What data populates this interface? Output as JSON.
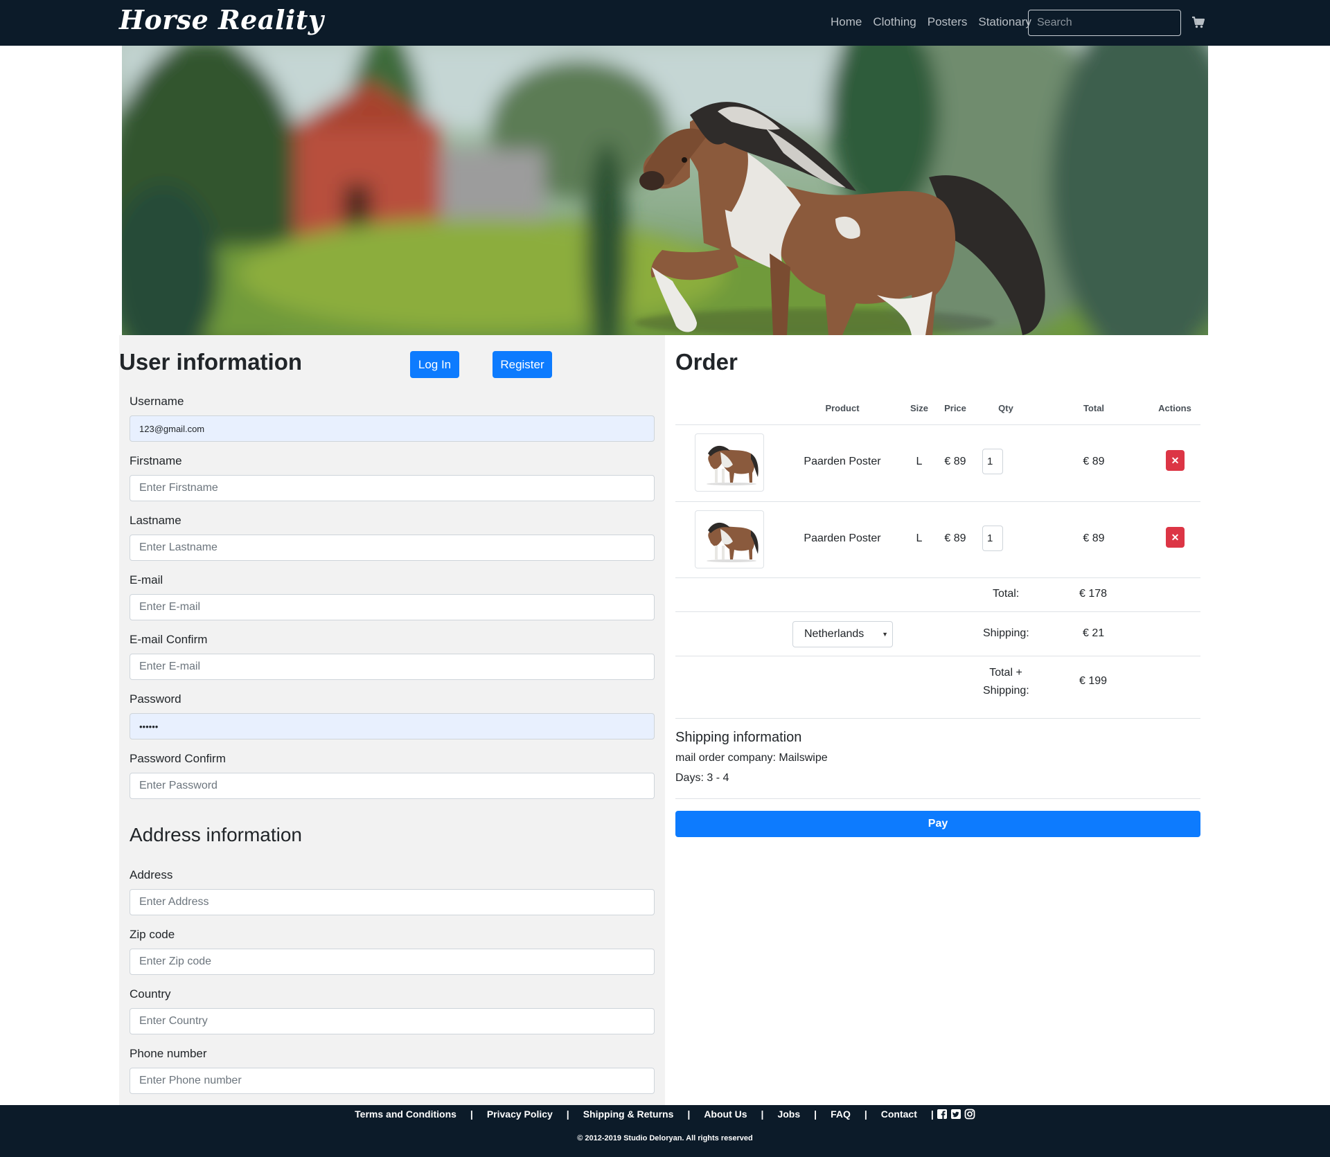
{
  "navbar": {
    "brand": "Horse Reality",
    "links": [
      "Home",
      "Clothing",
      "Posters",
      "Stationary"
    ],
    "search_placeholder": "Search",
    "cart_icon": "shopping-cart-icon"
  },
  "hero": {
    "image": "horse-banner-illustration"
  },
  "user_info": {
    "title": "User information",
    "login_label": "Log In",
    "register_label": "Register",
    "fields": [
      {
        "label": "Username",
        "value": "123@gmail.com",
        "placeholder": ""
      },
      {
        "label": "Firstname",
        "value": "",
        "placeholder": "Enter Firstname"
      },
      {
        "label": "Lastname",
        "value": "",
        "placeholder": "Enter Lastname"
      },
      {
        "label": "E-mail",
        "value": "",
        "placeholder": "Enter E-mail"
      },
      {
        "label": "E-mail Confirm",
        "value": "",
        "placeholder": "Enter E-mail"
      },
      {
        "label": "Password",
        "value": "••••••",
        "placeholder": ""
      },
      {
        "label": "Password Confirm",
        "value": "",
        "placeholder": "Enter Password"
      }
    ]
  },
  "address_info": {
    "title": "Address information",
    "fields": [
      {
        "label": "Address",
        "placeholder": "Enter Address"
      },
      {
        "label": "Zip code",
        "placeholder": "Enter Zip code"
      },
      {
        "label": "Country",
        "placeholder": "Enter Country"
      },
      {
        "label": "Phone number",
        "placeholder": "Enter Phone number"
      }
    ]
  },
  "order": {
    "title": "Order",
    "headers": {
      "product": "Product",
      "size": "Size",
      "price": "Price",
      "qty": "Qty",
      "total": "Total",
      "actions": "Actions"
    },
    "items": [
      {
        "product": "Paarden Poster",
        "size": "L",
        "price": "€ 89",
        "qty": "1",
        "total": "€ 89"
      },
      {
        "product": "Paarden Poster",
        "size": "L",
        "price": "€ 89",
        "qty": "1",
        "total": "€ 89"
      }
    ],
    "total_label": "Total:",
    "total_value": "€ 178",
    "country_selected": "Netherlands",
    "shipping_label": "Shipping:",
    "shipping_value": "€ 21",
    "total_shipping_label_1": "Total +",
    "total_shipping_label_2": "Shipping:",
    "total_shipping_value": "€ 199",
    "shipping_info_title": "Shipping information",
    "mail_company": "mail order company: Mailswipe",
    "days": "Days: 3 - 4",
    "pay_label": "Pay"
  },
  "footer": {
    "links": [
      "Terms and Conditions",
      "Privacy Policy",
      "Shipping & Returns",
      "About Us",
      "Jobs",
      "FAQ",
      "Contact"
    ],
    "social_icons": [
      "facebook-icon",
      "twitter-icon",
      "instagram-icon"
    ],
    "copyright": "© 2012-2019 Studio Deloryan. All rights reserved"
  },
  "colors": {
    "navbar_bg": "#0c1b29",
    "primary": "#0d7bfe",
    "danger": "#dc3545",
    "panel_bg": "#f2f2f2"
  }
}
